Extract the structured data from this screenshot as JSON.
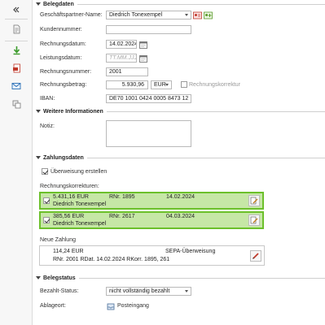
{
  "sidebar": {
    "icons": [
      "collapse-icon",
      "document-icon",
      "download-icon",
      "pdf-icon",
      "mail-icon",
      "copy-icon"
    ]
  },
  "belegdaten": {
    "title": "Belegdaten",
    "partner_label": "Geschäftspartner-Name:",
    "partner_value": "Diedrich Tonexempel",
    "kundennummer_label": "Kundennummer:",
    "kundennummer_value": "",
    "rechnungsdatum_label": "Rechnungsdatum:",
    "rechnungsdatum_value": "14.02.2024",
    "leistungsdatum_label": "Leistungsdatum:",
    "leistungsdatum_placeholder": "TT.MM.JJJJ",
    "rechnungsnummer_label": "Rechnungsnummer:",
    "rechnungsnummer_value": "2001",
    "rechnungsbetrag_label": "Rechnungsbetrag:",
    "rechnungsbetrag_value": "5.930,96",
    "currency_value": "EUR",
    "korrektur_label": "Rechnungskorrektur",
    "iban_label": "IBAN:",
    "iban_value": "DE70 1001 0424 0005 8473 12"
  },
  "weitere": {
    "title": "Weitere Informationen",
    "notiz_label": "Notiz:"
  },
  "zahlungsdaten": {
    "title": "Zahlungsdaten",
    "ueberweisung_label": "Überweisung erstellen",
    "korrekturen_label": "Rechnungskorrekturen:",
    "corrections": [
      {
        "amount": "5.431,16 EUR",
        "rnr": "RNr. 1895",
        "date": "14.02.2024",
        "name": "Diedrich Tonexempel"
      },
      {
        "amount": "385,56 EUR",
        "rnr": "RNr. 2617",
        "date": "04.03.2024",
        "name": "Diedrich Tonexempel"
      }
    ],
    "neue_zahlung_label": "Neue Zahlung",
    "payment": {
      "amount": "114,24 EUR",
      "method": "SEPA-Überweisung",
      "reference": "RNr. 2001 RDat. 14.02.2024 RKorr. 1895, 261"
    }
  },
  "belegstatus": {
    "title": "Belegstatus",
    "bezahlt_label": "Bezahlt-Status:",
    "bezahlt_value": "nicht vollständig bezahlt",
    "ablageort_label": "Ablageort:",
    "ablageort_value": "Posteingang"
  }
}
